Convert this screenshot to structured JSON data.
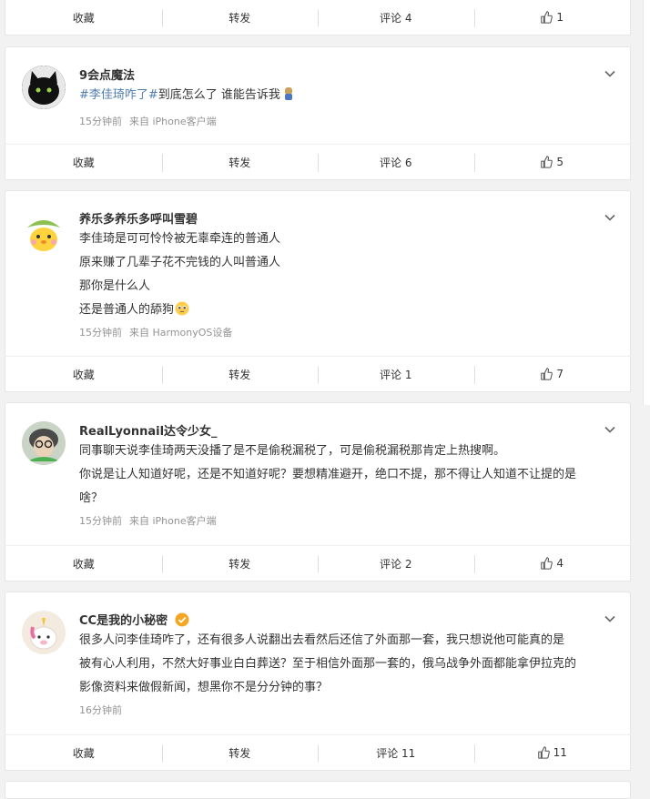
{
  "posts": [
    {
      "actions": {
        "collect": "收藏",
        "forward": "转发",
        "comment": "评论 4",
        "like": "1"
      }
    },
    {
      "user": "9会点魔法",
      "text_topic": "#李佳琦咋了#",
      "text_rest": "到底怎么了 谁能告诉我",
      "time": "15分钟前",
      "source": "来自 iPhone客户端",
      "actions": {
        "collect": "收藏",
        "forward": "转发",
        "comment": "评论 6",
        "like": "5"
      }
    },
    {
      "user": "养乐多养乐多呼叫雪碧",
      "lines": [
        "李佳琦是可可怜怜被无辜牵连的普通人",
        "原来赚了几辈子花不完钱的人叫普通人",
        "那你是什么人",
        "还是普通人的舔狗"
      ],
      "time": "15分钟前",
      "source": "来自 HarmonyOS设备",
      "actions": {
        "collect": "收藏",
        "forward": "转发",
        "comment": "评论 1",
        "like": "7"
      }
    },
    {
      "user": "RealLyonnail达令少女_",
      "lines": [
        "同事聊天说李佳琦两天没播了是不是偷税漏税了，可是偷税漏税那肯定上热搜啊。",
        "你说是让人知道好呢，还是不知道好呢？要想精准避开，绝口不提，那不得让人知道不让提的是",
        "啥？"
      ],
      "time": "15分钟前",
      "source": "来自 iPhone客户端",
      "actions": {
        "collect": "收藏",
        "forward": "转发",
        "comment": "评论 2",
        "like": "4"
      }
    },
    {
      "user": "CC是我的小秘密",
      "lines": [
        "很多人问李佳琦咋了，还有很多人说翻出去看然后还信了外面那一套，我只想说他可能真的是",
        "被有心人利用，不然大好事业白白葬送？至于相信外面那一套的，俄乌战争外面都能拿伊拉克的",
        "影像资料来做假新闻，想黑你不是分分钟的事？"
      ],
      "time": "16分钟前",
      "source": "",
      "actions": {
        "collect": "收藏",
        "forward": "转发",
        "comment": "评论 11",
        "like": "11"
      }
    }
  ],
  "colors": {
    "accent_link": "#507daf",
    "meta": "#939393",
    "verified": "#f5a623"
  },
  "icons": {
    "like": "thumbs-up-icon",
    "more": "chevron-down-icon",
    "verified": "verified-badge-icon"
  }
}
